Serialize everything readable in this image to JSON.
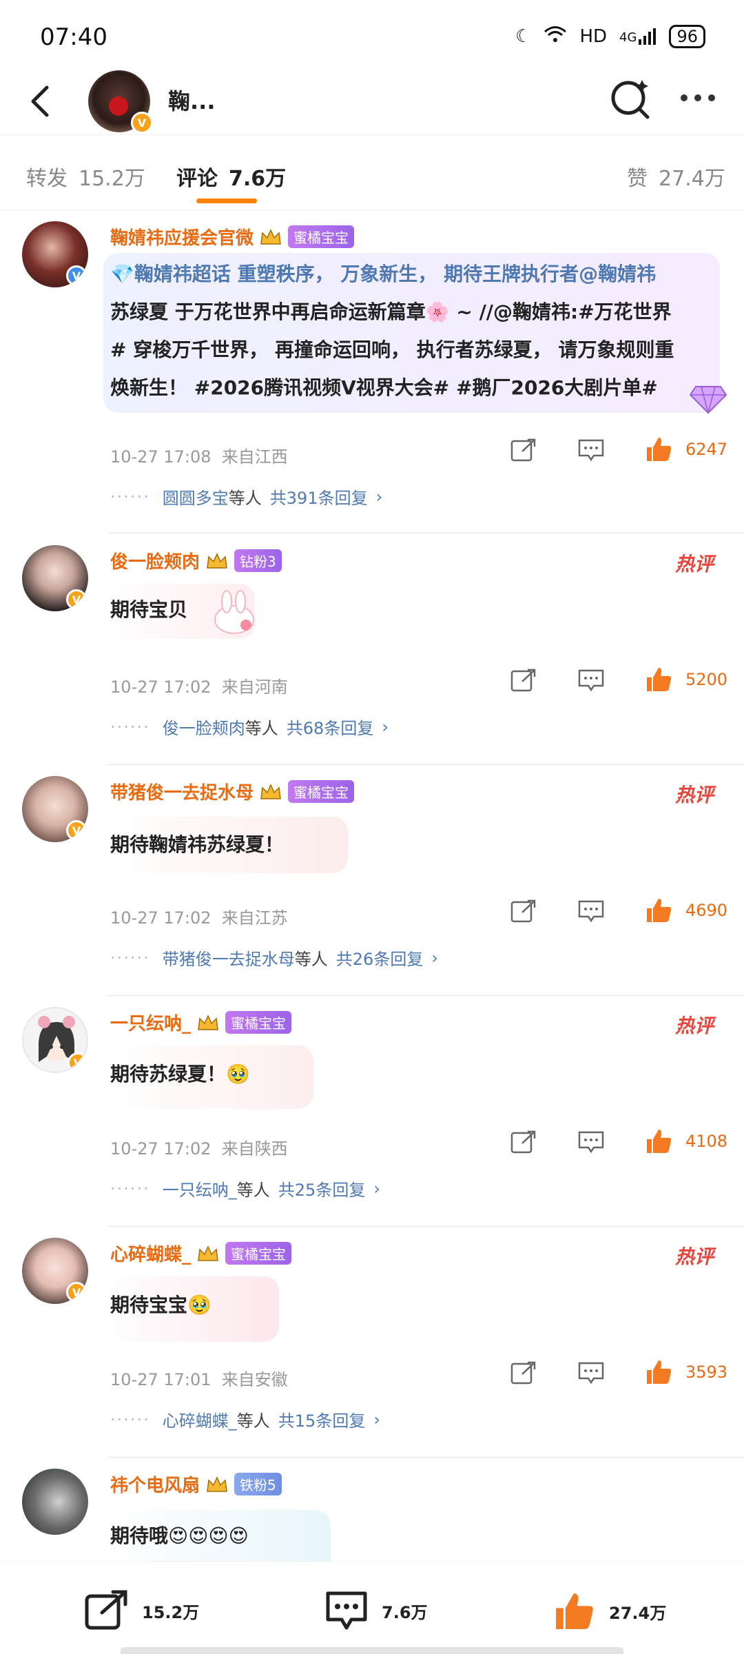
{
  "status": {
    "time": "07:40",
    "network": "HD",
    "cell": "4G",
    "battery": "96"
  },
  "header": {
    "title": "鞠..."
  },
  "tabs": {
    "repost_label": "转发",
    "repost_count": "15.2万",
    "comments_label": "评论",
    "comments_count": "7.6万",
    "likes_label": "赞",
    "likes_count": "27.4万"
  },
  "comments": [
    {
      "name": "鞠婧祎应援会官微",
      "fan_tag": "蜜橘宝宝",
      "text_lines": [
        "💎鞠婧祎超话 重塑秩序， 万象新生， 期待王牌执行者@鞠婧祎",
        "苏绿夏 于万花世界中再启命运新篇章🌸 ~ //@鞠婧祎:#万花世界",
        "# 穿梭万千世界， 再撞命运回响， 执行者苏绿夏， 请万象规则重",
        "焕新生！ #2026腾讯视频V视界大会# #鹅厂2026大剧片单#"
      ],
      "date": "10-27 17:08",
      "location": "来自江西",
      "likes": "6247",
      "reply_users": "圆圆多宝",
      "reply_suffix": "等人",
      "reply_total": "共391条回复"
    },
    {
      "name": "俊一脸颊肉",
      "fan_tag": "钻粉3",
      "hot": "热评",
      "text": "期待宝贝",
      "date": "10-27 17:02",
      "location": "来自河南",
      "likes": "5200",
      "reply_users": "俊一脸颊肉",
      "reply_suffix": "等人",
      "reply_total": "共68条回复"
    },
    {
      "name": "带猪俊一去捉水母",
      "fan_tag": "蜜橘宝宝",
      "hot": "热评",
      "text": "期待鞠婧祎苏绿夏！",
      "date": "10-27 17:02",
      "location": "来自江苏",
      "likes": "4690",
      "reply_users": "带猪俊一去捉水母",
      "reply_suffix": "等人",
      "reply_total": "共26条回复"
    },
    {
      "name": "一只纭呐_",
      "fan_tag": "蜜橘宝宝",
      "hot": "热评",
      "text": "期待苏绿夏！🥹",
      "date": "10-27 17:02",
      "location": "来自陕西",
      "likes": "4108",
      "reply_users": "一只纭呐_",
      "reply_suffix": "等人",
      "reply_total": "共25条回复"
    },
    {
      "name": "心碎蝴蝶_",
      "fan_tag": "蜜橘宝宝",
      "hot": "热评",
      "text": "期待宝宝🥹",
      "date": "10-27 17:01",
      "location": "来自安徽",
      "likes": "3593",
      "reply_users": "心碎蝴蝶_",
      "reply_suffix": "等人",
      "reply_total": "共15条回复"
    },
    {
      "name": "祎个电风扇",
      "fan_tag": "铁粉5",
      "text": "期待哦😍😍😍😍"
    }
  ],
  "bottom": {
    "repost": "15.2万",
    "comment": "7.6万",
    "like": "27.4万"
  },
  "colors": {
    "accent": "#ff8200",
    "name": "#e86b12",
    "link": "#4f79b3",
    "hot": "#e8453c"
  }
}
